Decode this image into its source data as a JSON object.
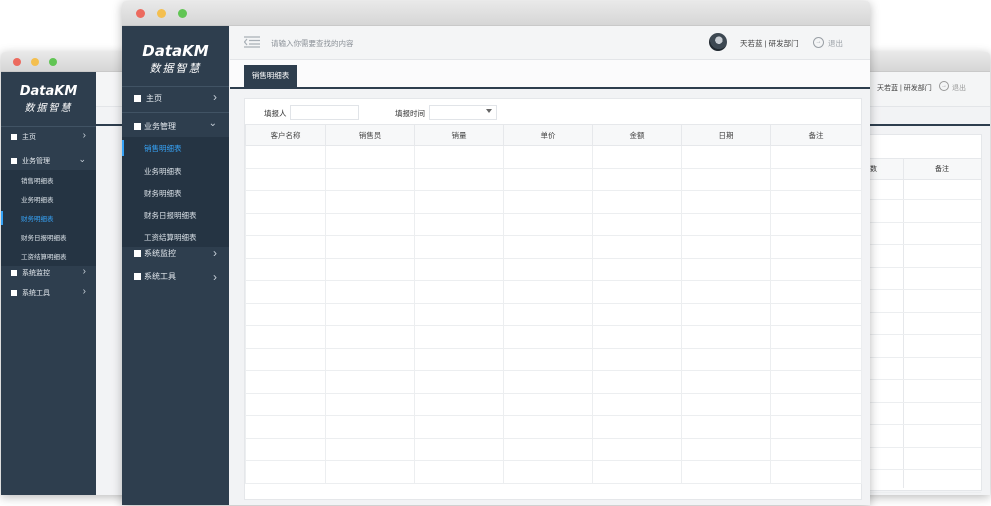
{
  "app": {
    "logo_en": "DataKM",
    "logo_cn": "数据智慧",
    "search_placeholder": "请输入你需要查找的内容",
    "user_info": "天若蓝 | 研发部门",
    "logout_label": "退出"
  },
  "front": {
    "nav": {
      "home": "主页",
      "business": "业务管理",
      "monitor": "系统监控",
      "tools": "系统工具"
    },
    "submenu": [
      "销售明细表",
      "业务明细表",
      "财务明细表",
      "财务日报明细表",
      "工资结算明细表"
    ],
    "active_sub_index": 0,
    "tab_label": "销售明细表",
    "filters": {
      "reporter_label": "填报人",
      "reporter_value": "",
      "date_label": "填报时间",
      "date_value": ""
    },
    "table_columns": [
      "客户名称",
      "销售员",
      "销量",
      "单价",
      "金额",
      "日期",
      "备注"
    ],
    "row_count": 15
  },
  "back": {
    "nav": {
      "home": "主页",
      "business": "业务管理",
      "monitor": "系统监控",
      "tools": "系统工具"
    },
    "submenu": [
      "销售明细表",
      "业务明细表",
      "财务明细表",
      "财务日报明细表",
      "工资结算明细表"
    ],
    "active_sub_index": 2,
    "user_info": "天若蓝 | 研发部门",
    "logout_label": "退出",
    "visible_columns": [
      "数",
      "备注"
    ]
  },
  "colors": {
    "sidebar": "#2e3e4e",
    "submenu_bg": "#253443",
    "active": "#36a3f7",
    "close_dot": "#ec6a5e",
    "min_dot": "#f4bf4f",
    "max_dot": "#61c554"
  }
}
